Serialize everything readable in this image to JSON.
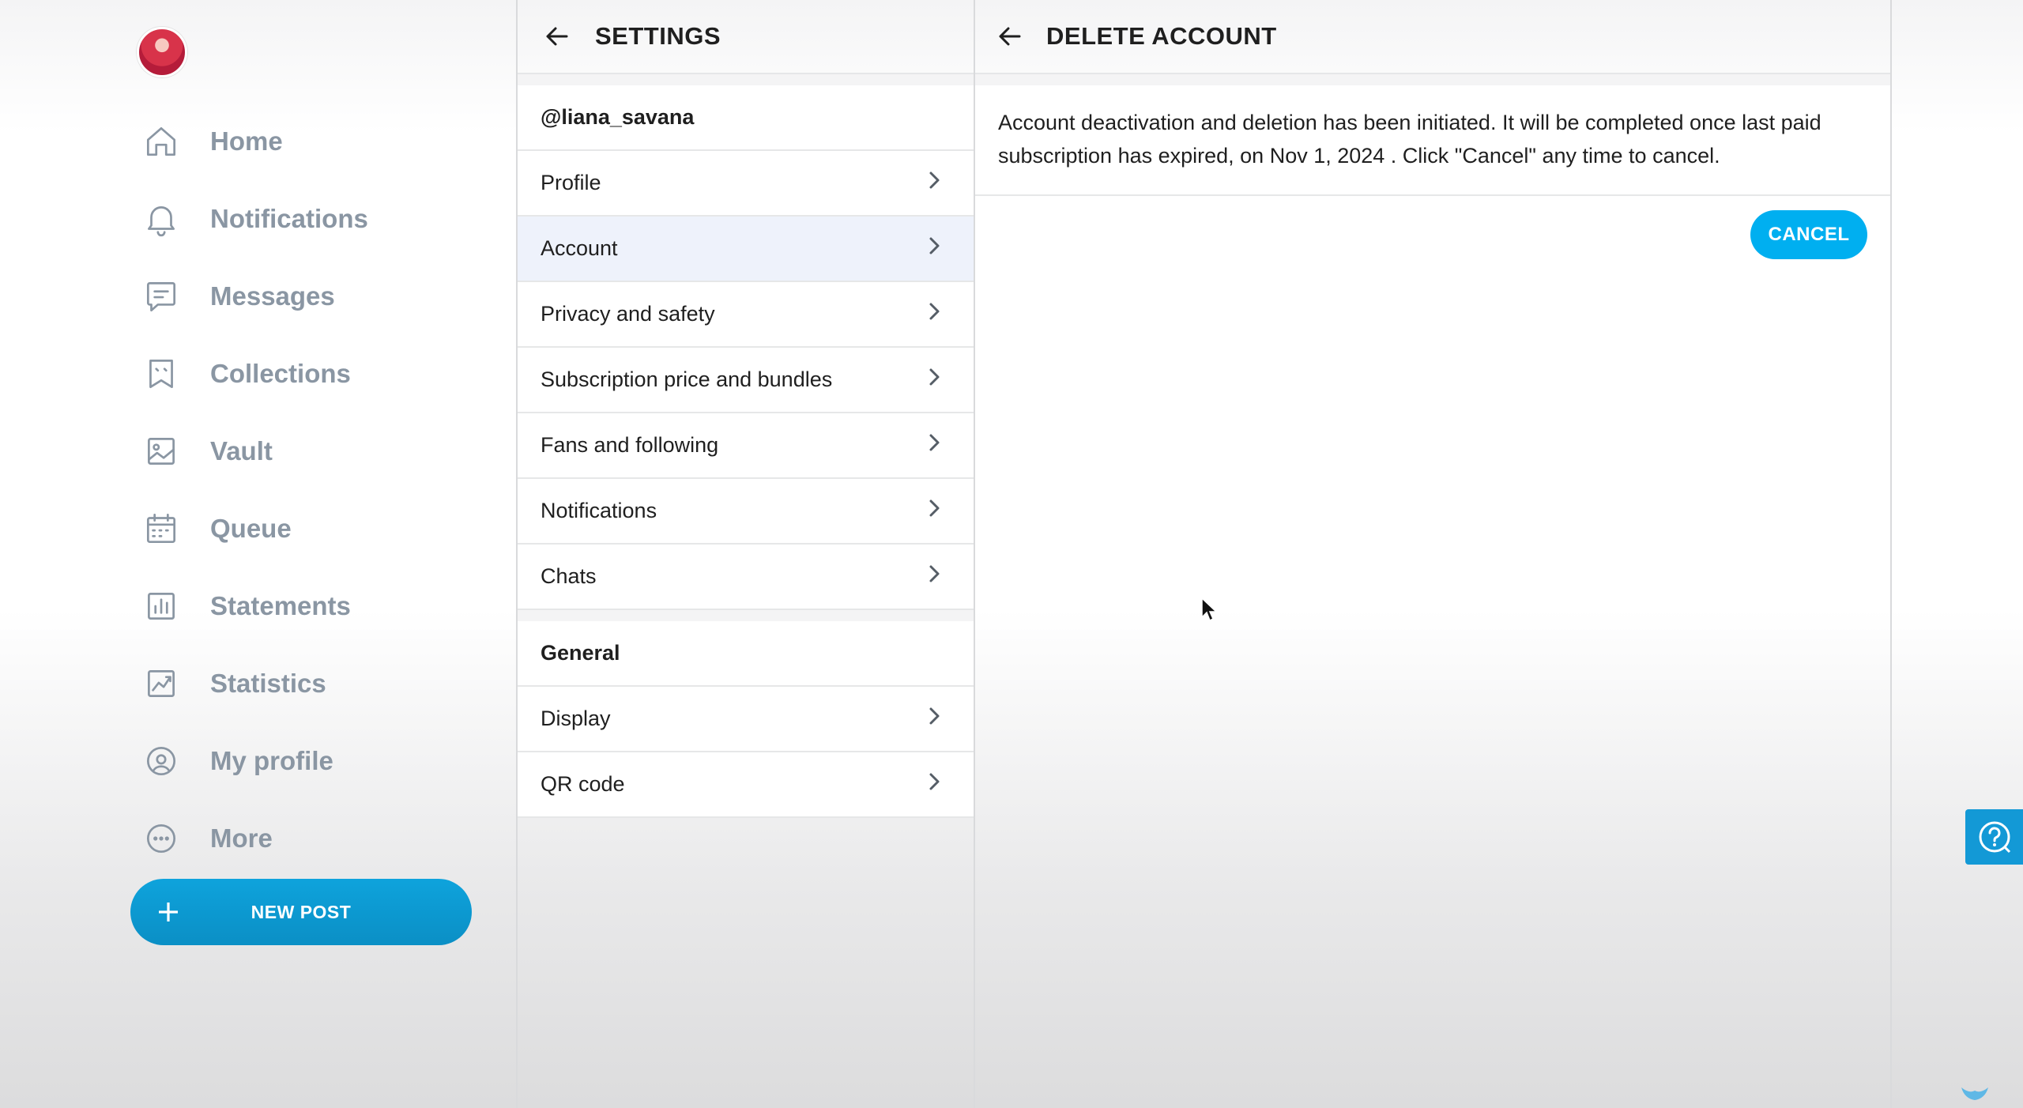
{
  "sidebar": {
    "items": [
      {
        "label": "Home",
        "icon": "home-icon"
      },
      {
        "label": "Notifications",
        "icon": "bell-icon"
      },
      {
        "label": "Messages",
        "icon": "message-icon"
      },
      {
        "label": "Collections",
        "icon": "bookmark-icon"
      },
      {
        "label": "Vault",
        "icon": "image-icon"
      },
      {
        "label": "Queue",
        "icon": "calendar-icon"
      },
      {
        "label": "Statements",
        "icon": "bar-chart-icon"
      },
      {
        "label": "Statistics",
        "icon": "line-chart-icon"
      },
      {
        "label": "My profile",
        "icon": "user-circle-icon"
      },
      {
        "label": "More",
        "icon": "more-icon"
      }
    ],
    "new_post_label": "NEW POST"
  },
  "settings": {
    "title": "SETTINGS",
    "username": "@liana_savana",
    "account_items": [
      {
        "label": "Profile"
      },
      {
        "label": "Account",
        "active": true
      },
      {
        "label": "Privacy and safety"
      },
      {
        "label": "Subscription price and bundles"
      },
      {
        "label": "Fans and following"
      },
      {
        "label": "Notifications"
      },
      {
        "label": "Chats"
      }
    ],
    "general_header": "General",
    "general_items": [
      {
        "label": "Display"
      },
      {
        "label": "QR code"
      }
    ]
  },
  "delete_account": {
    "title": "DELETE ACCOUNT",
    "notice": "Account deactivation and deletion has been initiated. It will be completed once last paid subscription has expired, on Nov 1, 2024 . Click \"Cancel\" any time to cancel.",
    "cancel_label": "CANCEL"
  },
  "colors": {
    "accent": "#00aff0",
    "nav_text": "#8a96a3",
    "active_row": "#eef2fb",
    "help_tab": "#1399d6"
  }
}
